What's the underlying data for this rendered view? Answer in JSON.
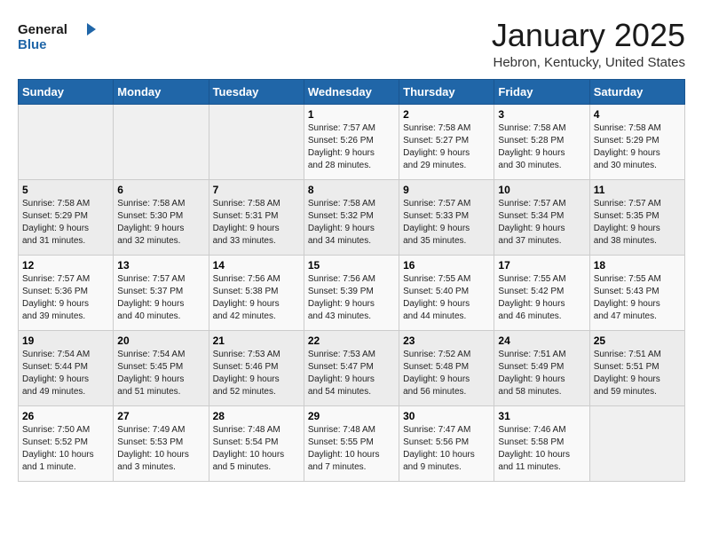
{
  "header": {
    "logo_line1": "General",
    "logo_line2": "Blue",
    "title": "January 2025",
    "subtitle": "Hebron, Kentucky, United States"
  },
  "weekdays": [
    "Sunday",
    "Monday",
    "Tuesday",
    "Wednesday",
    "Thursday",
    "Friday",
    "Saturday"
  ],
  "weeks": [
    [
      {
        "day": "",
        "info": ""
      },
      {
        "day": "",
        "info": ""
      },
      {
        "day": "",
        "info": ""
      },
      {
        "day": "1",
        "info": "Sunrise: 7:57 AM\nSunset: 5:26 PM\nDaylight: 9 hours\nand 28 minutes."
      },
      {
        "day": "2",
        "info": "Sunrise: 7:58 AM\nSunset: 5:27 PM\nDaylight: 9 hours\nand 29 minutes."
      },
      {
        "day": "3",
        "info": "Sunrise: 7:58 AM\nSunset: 5:28 PM\nDaylight: 9 hours\nand 30 minutes."
      },
      {
        "day": "4",
        "info": "Sunrise: 7:58 AM\nSunset: 5:29 PM\nDaylight: 9 hours\nand 30 minutes."
      }
    ],
    [
      {
        "day": "5",
        "info": "Sunrise: 7:58 AM\nSunset: 5:29 PM\nDaylight: 9 hours\nand 31 minutes."
      },
      {
        "day": "6",
        "info": "Sunrise: 7:58 AM\nSunset: 5:30 PM\nDaylight: 9 hours\nand 32 minutes."
      },
      {
        "day": "7",
        "info": "Sunrise: 7:58 AM\nSunset: 5:31 PM\nDaylight: 9 hours\nand 33 minutes."
      },
      {
        "day": "8",
        "info": "Sunrise: 7:58 AM\nSunset: 5:32 PM\nDaylight: 9 hours\nand 34 minutes."
      },
      {
        "day": "9",
        "info": "Sunrise: 7:57 AM\nSunset: 5:33 PM\nDaylight: 9 hours\nand 35 minutes."
      },
      {
        "day": "10",
        "info": "Sunrise: 7:57 AM\nSunset: 5:34 PM\nDaylight: 9 hours\nand 37 minutes."
      },
      {
        "day": "11",
        "info": "Sunrise: 7:57 AM\nSunset: 5:35 PM\nDaylight: 9 hours\nand 38 minutes."
      }
    ],
    [
      {
        "day": "12",
        "info": "Sunrise: 7:57 AM\nSunset: 5:36 PM\nDaylight: 9 hours\nand 39 minutes."
      },
      {
        "day": "13",
        "info": "Sunrise: 7:57 AM\nSunset: 5:37 PM\nDaylight: 9 hours\nand 40 minutes."
      },
      {
        "day": "14",
        "info": "Sunrise: 7:56 AM\nSunset: 5:38 PM\nDaylight: 9 hours\nand 42 minutes."
      },
      {
        "day": "15",
        "info": "Sunrise: 7:56 AM\nSunset: 5:39 PM\nDaylight: 9 hours\nand 43 minutes."
      },
      {
        "day": "16",
        "info": "Sunrise: 7:55 AM\nSunset: 5:40 PM\nDaylight: 9 hours\nand 44 minutes."
      },
      {
        "day": "17",
        "info": "Sunrise: 7:55 AM\nSunset: 5:42 PM\nDaylight: 9 hours\nand 46 minutes."
      },
      {
        "day": "18",
        "info": "Sunrise: 7:55 AM\nSunset: 5:43 PM\nDaylight: 9 hours\nand 47 minutes."
      }
    ],
    [
      {
        "day": "19",
        "info": "Sunrise: 7:54 AM\nSunset: 5:44 PM\nDaylight: 9 hours\nand 49 minutes."
      },
      {
        "day": "20",
        "info": "Sunrise: 7:54 AM\nSunset: 5:45 PM\nDaylight: 9 hours\nand 51 minutes."
      },
      {
        "day": "21",
        "info": "Sunrise: 7:53 AM\nSunset: 5:46 PM\nDaylight: 9 hours\nand 52 minutes."
      },
      {
        "day": "22",
        "info": "Sunrise: 7:53 AM\nSunset: 5:47 PM\nDaylight: 9 hours\nand 54 minutes."
      },
      {
        "day": "23",
        "info": "Sunrise: 7:52 AM\nSunset: 5:48 PM\nDaylight: 9 hours\nand 56 minutes."
      },
      {
        "day": "24",
        "info": "Sunrise: 7:51 AM\nSunset: 5:49 PM\nDaylight: 9 hours\nand 58 minutes."
      },
      {
        "day": "25",
        "info": "Sunrise: 7:51 AM\nSunset: 5:51 PM\nDaylight: 9 hours\nand 59 minutes."
      }
    ],
    [
      {
        "day": "26",
        "info": "Sunrise: 7:50 AM\nSunset: 5:52 PM\nDaylight: 10 hours\nand 1 minute."
      },
      {
        "day": "27",
        "info": "Sunrise: 7:49 AM\nSunset: 5:53 PM\nDaylight: 10 hours\nand 3 minutes."
      },
      {
        "day": "28",
        "info": "Sunrise: 7:48 AM\nSunset: 5:54 PM\nDaylight: 10 hours\nand 5 minutes."
      },
      {
        "day": "29",
        "info": "Sunrise: 7:48 AM\nSunset: 5:55 PM\nDaylight: 10 hours\nand 7 minutes."
      },
      {
        "day": "30",
        "info": "Sunrise: 7:47 AM\nSunset: 5:56 PM\nDaylight: 10 hours\nand 9 minutes."
      },
      {
        "day": "31",
        "info": "Sunrise: 7:46 AM\nSunset: 5:58 PM\nDaylight: 10 hours\nand 11 minutes."
      },
      {
        "day": "",
        "info": ""
      }
    ]
  ]
}
